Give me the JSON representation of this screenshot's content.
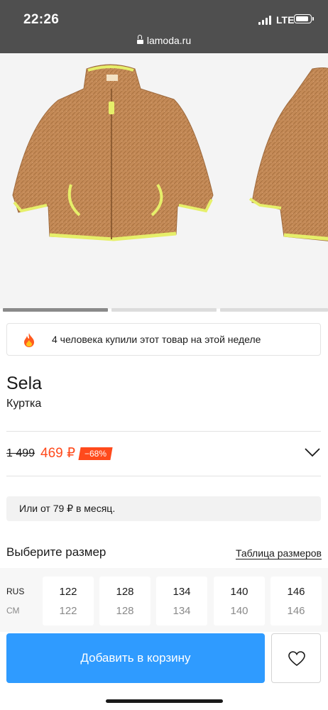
{
  "status_bar": {
    "time": "22:26",
    "network": "LTE",
    "battery_level": 0.75
  },
  "browser": {
    "url": "lamoda.ru"
  },
  "gallery": {
    "image_count": 3,
    "active_index": 0
  },
  "social_proof": {
    "icon": "fire-icon",
    "text": "4 человека купили этот товар на этой неделе"
  },
  "product": {
    "brand": "Sela",
    "type": "Куртка"
  },
  "price": {
    "old": "1 499",
    "new": "469 ₽",
    "discount": "−68%"
  },
  "installment": {
    "text": "Или от 79 ₽ в месяц."
  },
  "size_section": {
    "title": "Выберите размер",
    "table_link": "Таблица размеров",
    "row_labels": {
      "rus": "RUS",
      "cm": "СМ"
    },
    "sizes": [
      {
        "rus": "122",
        "cm": "122"
      },
      {
        "rus": "128",
        "cm": "128"
      },
      {
        "rus": "134",
        "cm": "134"
      },
      {
        "rus": "140",
        "cm": "140"
      },
      {
        "rus": "146",
        "cm": "146"
      }
    ]
  },
  "actions": {
    "add_to_cart": "Добавить в корзину",
    "wishlist_icon": "heart-icon"
  },
  "colors": {
    "accent": "#2f9bff",
    "sale": "#ff4a1c",
    "fur": "#c48a57",
    "trim": "#e6ef6a"
  }
}
